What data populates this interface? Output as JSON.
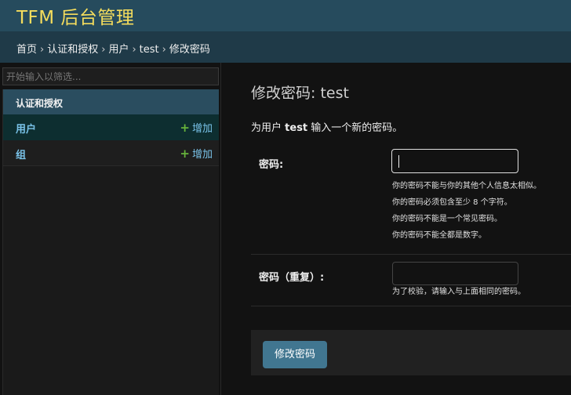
{
  "header": {
    "brand": "TFM 后台管理"
  },
  "breadcrumbs": [
    {
      "label": "首页"
    },
    {
      "label": "认证和授权"
    },
    {
      "label": "用户"
    },
    {
      "label": "test"
    },
    {
      "label": "修改密码"
    }
  ],
  "breadcrumb_separator": "›",
  "sidebar": {
    "filter_placeholder": "开始输入以筛选...",
    "module_caption": "认证和授权",
    "models": [
      {
        "label": "用户",
        "add_label": "增加",
        "current": true
      },
      {
        "label": "组",
        "add_label": "增加",
        "current": false
      }
    ],
    "add_icon": "plus-icon"
  },
  "content": {
    "title": "修改密码: test",
    "intro_prefix": "为用户",
    "intro_user": "test",
    "intro_suffix": "输入一个新的密码。",
    "password_label": "密码:",
    "password_value": "",
    "password_help": [
      "你的密码不能与你的其他个人信息太相似。",
      "你的密码必须包含至少 8 个字符。",
      "你的密码不能是一个常见密码。",
      "你的密码不能全都是数字。"
    ],
    "password2_label": "密码（重复）:",
    "password2_value": "",
    "password2_help": "为了校验，请输入与上面相同的密码。",
    "submit_label": "修改密码"
  },
  "colors": {
    "brand": "#f5dd5d",
    "header_bg": "#264b5d",
    "link": "#79c2e8",
    "add_plus": "#67b33b",
    "button_bg": "#417690"
  }
}
